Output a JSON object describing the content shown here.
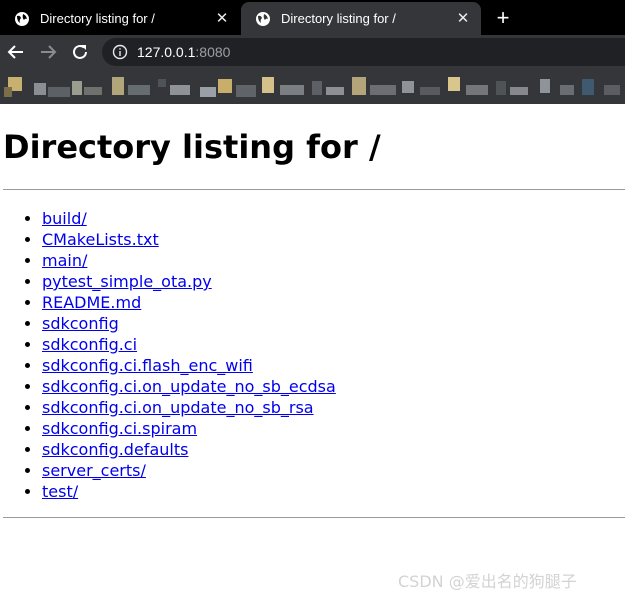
{
  "browser": {
    "tabs": [
      {
        "title": "Directory listing for /",
        "active": false
      },
      {
        "title": "Directory listing for /",
        "active": true
      }
    ],
    "new_tab_label": "+",
    "close_label": "✕",
    "address": {
      "host": "127.0.0.1",
      "port": ":8080"
    },
    "colors": {
      "tabstrip": "#000000",
      "toolbar": "#35363a",
      "omnibox": "#202124"
    }
  },
  "page": {
    "heading": "Directory listing for /",
    "entries": [
      "build/",
      "CMakeLists.txt",
      "main/",
      "pytest_simple_ota.py",
      "README.md",
      "sdkconfig",
      "sdkconfig.ci",
      "sdkconfig.ci.flash_enc_wifi",
      "sdkconfig.ci.on_update_no_sb_ecdsa",
      "sdkconfig.ci.on_update_no_sb_rsa",
      "sdkconfig.ci.spiram",
      "sdkconfig.defaults",
      "server_certs/",
      "test/"
    ],
    "link_color": "#0000ee"
  },
  "watermark": "CSDN @爱出名的狗腿子"
}
